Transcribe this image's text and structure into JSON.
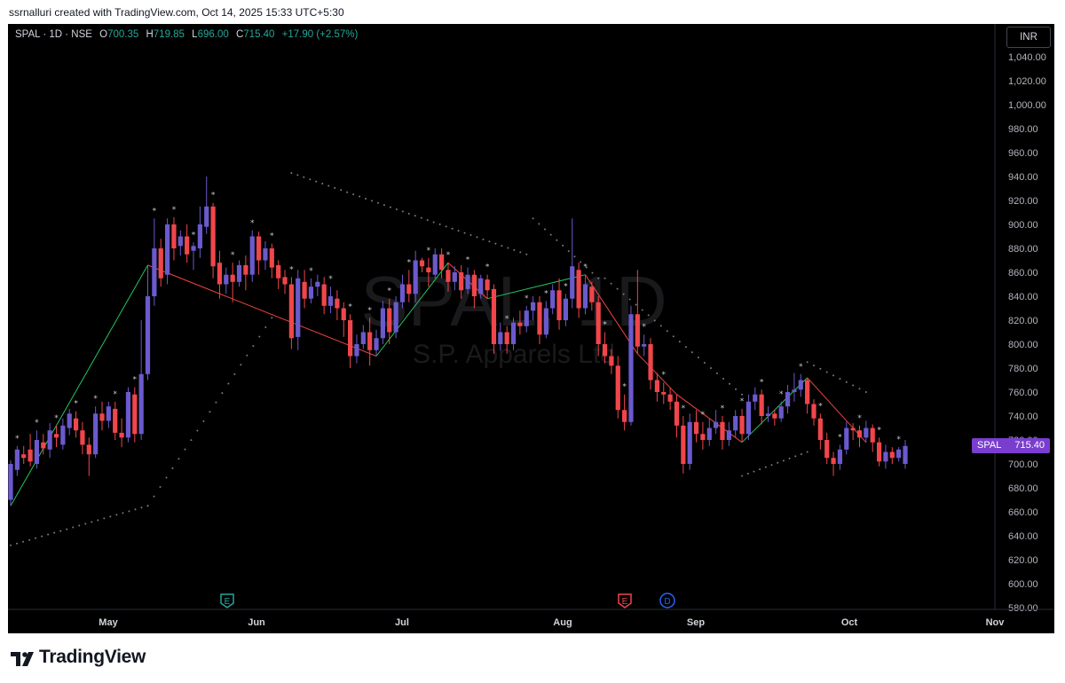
{
  "creator_line": "ssrnalluri created with TradingView.com, Oct 14, 2025 15:33 UTC+5:30",
  "legend": {
    "symbol_line": "SPAL · 1D · NSE",
    "open_label": "O",
    "open": "700.35",
    "high_label": "H",
    "high": "719.85",
    "low_label": "L",
    "low": "696.00",
    "close_label": "C",
    "close": "715.40",
    "change": "+17.90 (+2.57%)"
  },
  "currency": "INR",
  "watermark": {
    "symbol": "SPAL, 1D",
    "name": "S.P. Apparels Ltd"
  },
  "last_price_tag": {
    "symbol": "SPAL",
    "price": "715.40"
  },
  "footer_brand": "TradingView",
  "colors": {
    "background": "#000000",
    "up_candle": "#6a5acd",
    "down_candle": "#f0464b",
    "zigzag_up": "#22c55e",
    "zigzag_down": "#ef4444",
    "dots": "#787b86",
    "axis_text": "#b2b5be",
    "price_tag": "#7a3ecf"
  },
  "chart_data": {
    "type": "candlestick",
    "y_axis": {
      "ticks": [
        "580.00",
        "600.00",
        "620.00",
        "640.00",
        "660.00",
        "680.00",
        "700.00",
        "720.00",
        "740.00",
        "760.00",
        "780.00",
        "800.00",
        "820.00",
        "840.00",
        "860.00",
        "880.00",
        "900.00",
        "920.00",
        "940.00",
        "960.00",
        "980.00",
        "1,000.00",
        "1,020.00",
        "1,040.00"
      ],
      "range": [
        580,
        1050
      ]
    },
    "x_axis": {
      "ticks": [
        "May",
        "Jun",
        "Jul",
        "Aug",
        "Sep",
        "Oct",
        "Nov"
      ]
    },
    "event_markers": [
      {
        "label": "E",
        "month": "May-Jun",
        "color": "#26a69a"
      },
      {
        "label": "E",
        "month": "Aug",
        "color": "#f0464b"
      },
      {
        "label": "D",
        "month": "Aug",
        "color": "#2962ff"
      }
    ],
    "candles": [
      [
        670,
        700,
        665,
        703
      ],
      [
        695,
        712,
        690,
        715
      ],
      [
        708,
        705,
        700,
        715
      ],
      [
        712,
        702,
        698,
        725
      ],
      [
        700,
        720,
        696,
        728
      ],
      [
        718,
        713,
        708,
        725
      ],
      [
        712,
        728,
        705,
        734
      ],
      [
        725,
        722,
        714,
        732
      ],
      [
        716,
        732,
        712,
        738
      ],
      [
        730,
        742,
        724,
        746
      ],
      [
        738,
        728,
        722,
        744
      ],
      [
        728,
        716,
        708,
        735
      ],
      [
        716,
        708,
        690,
        722
      ],
      [
        708,
        742,
        705,
        748
      ],
      [
        742,
        736,
        728,
        752
      ],
      [
        736,
        748,
        730,
        752
      ],
      [
        746,
        726,
        720,
        752
      ],
      [
        726,
        722,
        714,
        738
      ],
      [
        722,
        760,
        718,
        764
      ],
      [
        758,
        725,
        718,
        764
      ],
      [
        725,
        775,
        720,
        820
      ],
      [
        775,
        840,
        770,
        866
      ],
      [
        840,
        880,
        832,
        905
      ],
      [
        880,
        855,
        848,
        888
      ],
      [
        858,
        900,
        850,
        905
      ],
      [
        900,
        880,
        870,
        906
      ],
      [
        882,
        890,
        874,
        895
      ],
      [
        890,
        875,
        868,
        900
      ],
      [
        878,
        882,
        862,
        885
      ],
      [
        880,
        900,
        872,
        915
      ],
      [
        898,
        915,
        892,
        940
      ],
      [
        915,
        865,
        855,
        918
      ],
      [
        868,
        850,
        838,
        878
      ],
      [
        850,
        858,
        842,
        864
      ],
      [
        858,
        852,
        835,
        868
      ],
      [
        852,
        866,
        848,
        870
      ],
      [
        866,
        858,
        845,
        874
      ],
      [
        858,
        890,
        852,
        895
      ],
      [
        890,
        870,
        858,
        894
      ],
      [
        870,
        880,
        862,
        886
      ],
      [
        880,
        864,
        855,
        884
      ],
      [
        866,
        855,
        846,
        870
      ],
      [
        856,
        850,
        842,
        862
      ],
      [
        850,
        805,
        796,
        856
      ],
      [
        806,
        855,
        795,
        862
      ],
      [
        852,
        838,
        830,
        862
      ],
      [
        838,
        848,
        834,
        855
      ],
      [
        848,
        852,
        840,
        858
      ],
      [
        850,
        832,
        825,
        856
      ],
      [
        832,
        840,
        826,
        848
      ],
      [
        838,
        830,
        820,
        845
      ],
      [
        830,
        820,
        806,
        835
      ],
      [
        820,
        790,
        780,
        825
      ],
      [
        790,
        800,
        784,
        808
      ],
      [
        800,
        810,
        796,
        816
      ],
      [
        810,
        795,
        782,
        822
      ],
      [
        795,
        805,
        790,
        812
      ],
      [
        805,
        830,
        800,
        836
      ],
      [
        830,
        810,
        800,
        838
      ],
      [
        810,
        835,
        805,
        840
      ],
      [
        835,
        850,
        830,
        858
      ],
      [
        850,
        842,
        835,
        862
      ],
      [
        842,
        870,
        835,
        878
      ],
      [
        870,
        865,
        860,
        872
      ],
      [
        864,
        860,
        848,
        872
      ],
      [
        858,
        875,
        855,
        880
      ],
      [
        875,
        862,
        855,
        880
      ],
      [
        862,
        852,
        844,
        868
      ],
      [
        852,
        860,
        845,
        865
      ],
      [
        860,
        845,
        838,
        866
      ],
      [
        846,
        858,
        842,
        864
      ],
      [
        858,
        840,
        830,
        862
      ],
      [
        842,
        855,
        838,
        858
      ],
      [
        854,
        845,
        838,
        858
      ],
      [
        846,
        800,
        792,
        850
      ],
      [
        800,
        810,
        795,
        818
      ],
      [
        810,
        800,
        792,
        815
      ],
      [
        800,
        818,
        795,
        822
      ],
      [
        818,
        815,
        808,
        828
      ],
      [
        815,
        828,
        810,
        832
      ],
      [
        828,
        835,
        820,
        840
      ],
      [
        835,
        808,
        800,
        840
      ],
      [
        808,
        830,
        805,
        836
      ],
      [
        830,
        845,
        825,
        850
      ],
      [
        845,
        820,
        812,
        855
      ],
      [
        820,
        838,
        815,
        842
      ],
      [
        838,
        865,
        830,
        905
      ],
      [
        862,
        830,
        822,
        868
      ],
      [
        830,
        850,
        825,
        858
      ],
      [
        848,
        835,
        828,
        852
      ],
      [
        835,
        800,
        790,
        840
      ],
      [
        800,
        790,
        784,
        810
      ],
      [
        790,
        782,
        775,
        796
      ],
      [
        782,
        745,
        738,
        790
      ],
      [
        745,
        735,
        728,
        758
      ],
      [
        735,
        825,
        732,
        832
      ],
      [
        825,
        798,
        792,
        862
      ],
      [
        798,
        800,
        790,
        808
      ],
      [
        800,
        770,
        762,
        805
      ],
      [
        770,
        760,
        752,
        776
      ],
      [
        760,
        758,
        750,
        768
      ],
      [
        758,
        752,
        745,
        764
      ],
      [
        752,
        732,
        722,
        758
      ],
      [
        732,
        700,
        692,
        740
      ],
      [
        700,
        735,
        695,
        742
      ],
      [
        735,
        725,
        718,
        745
      ],
      [
        725,
        720,
        712,
        735
      ],
      [
        720,
        730,
        715,
        738
      ],
      [
        730,
        735,
        725,
        745
      ],
      [
        735,
        720,
        712,
        740
      ],
      [
        720,
        728,
        715,
        735
      ],
      [
        728,
        740,
        722,
        745
      ],
      [
        740,
        725,
        718,
        746
      ],
      [
        725,
        752,
        720,
        758
      ],
      [
        752,
        758,
        745,
        764
      ],
      [
        758,
        740,
        733,
        762
      ],
      [
        740,
        742,
        735,
        748
      ],
      [
        742,
        738,
        732,
        745
      ],
      [
        738,
        748,
        735,
        752
      ],
      [
        748,
        760,
        742,
        766
      ],
      [
        760,
        762,
        752,
        776
      ],
      [
        762,
        770,
        756,
        775
      ],
      [
        770,
        750,
        742,
        772
      ],
      [
        750,
        738,
        732,
        754
      ],
      [
        738,
        720,
        712,
        742
      ],
      [
        720,
        705,
        700,
        726
      ],
      [
        705,
        700,
        690,
        710
      ],
      [
        700,
        712,
        695,
        716
      ],
      [
        712,
        730,
        708,
        735
      ],
      [
        730,
        728,
        720,
        734
      ],
      [
        728,
        722,
        714,
        732
      ],
      [
        722,
        730,
        718,
        736
      ],
      [
        730,
        718,
        710,
        733
      ],
      [
        718,
        702,
        698,
        722
      ],
      [
        702,
        710,
        696,
        716
      ],
      [
        710,
        705,
        700,
        714
      ],
      [
        705,
        712,
        702,
        714
      ],
      [
        700,
        715,
        696,
        720
      ]
    ]
  }
}
